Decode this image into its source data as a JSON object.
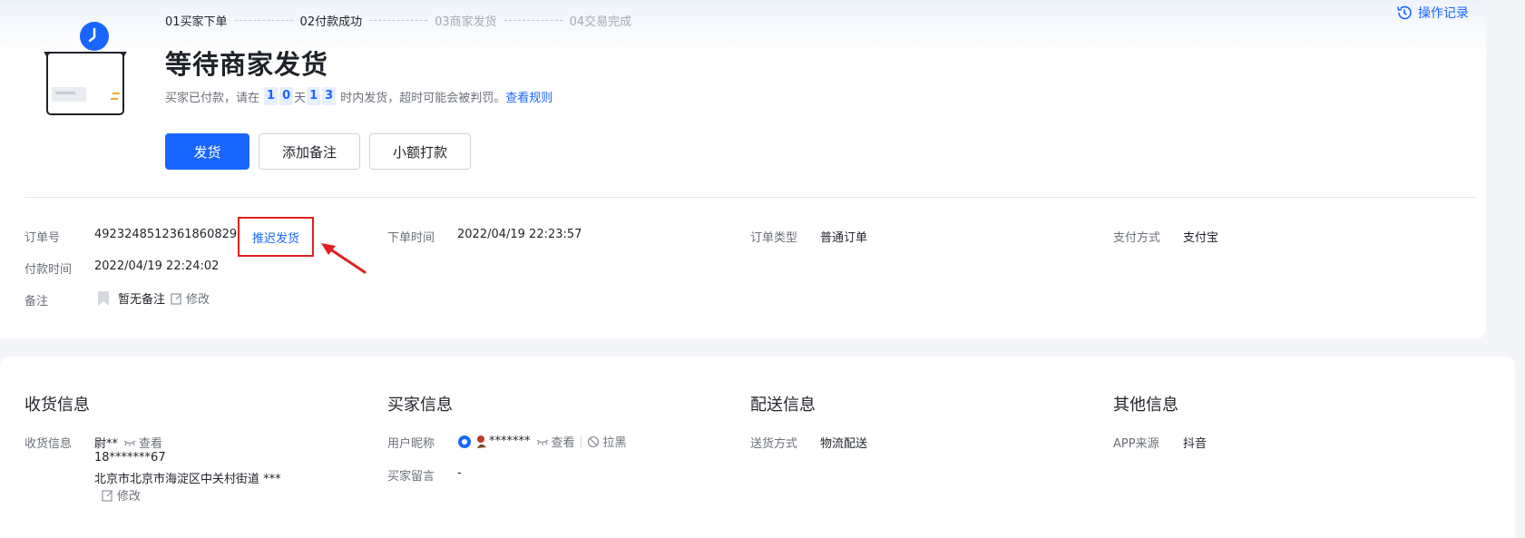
{
  "progress": {
    "steps": [
      {
        "label": "01买家下单",
        "state": "done"
      },
      {
        "label": "02付款成功",
        "state": "done"
      },
      {
        "label": "03商家发货",
        "state": "pending"
      },
      {
        "label": "04交易完成",
        "state": "pending"
      }
    ]
  },
  "header": {
    "history_label": "操作记录",
    "title": "等待商家发货",
    "subtitle_prefix": "买家已付款，请在",
    "days_digits": [
      "1",
      "0"
    ],
    "days_unit": "天",
    "hours_digits": [
      "1",
      "3"
    ],
    "subtitle_suffix": "时内发货，超时可能会被判罚。",
    "rules_link": "查看规则"
  },
  "actions": {
    "ship_label": "发货",
    "add_note_label": "添加备注",
    "small_payment_label": "小额打款"
  },
  "order": {
    "order_no_label": "订单号",
    "order_no": "4923248512361860829",
    "delay_ship_label": "推迟发货",
    "order_time_label": "下单时间",
    "order_time": "2022/04/19 22:23:57",
    "order_type_label": "订单类型",
    "order_type": "普通订单",
    "pay_method_label": "支付方式",
    "pay_method": "支付宝",
    "pay_time_label": "付款时间",
    "pay_time": "2022/04/19 22:24:02",
    "note_label": "备注",
    "note_value": "暂无备注",
    "edit_label": "修改"
  },
  "receiver": {
    "section_title": "收货信息",
    "label": "收货信息",
    "name": "尉**",
    "view_label": "查看",
    "phone": "18*******67",
    "address": "北京市北京市海淀区中关村街道 ***",
    "edit_label": "修改"
  },
  "buyer": {
    "section_title": "买家信息",
    "nickname_label": "用户昵称",
    "nickname": "*******",
    "view_label": "查看",
    "block_label": "拉黑",
    "message_label": "买家留言",
    "message": "-"
  },
  "delivery": {
    "section_title": "配送信息",
    "method_label": "送货方式",
    "method": "物流配送"
  },
  "other": {
    "section_title": "其他信息",
    "app_source_label": "APP来源",
    "app_source": "抖音"
  },
  "colors": {
    "accent": "#1966ff",
    "highlight_border": "#e02020",
    "arrow": "#e02020"
  }
}
